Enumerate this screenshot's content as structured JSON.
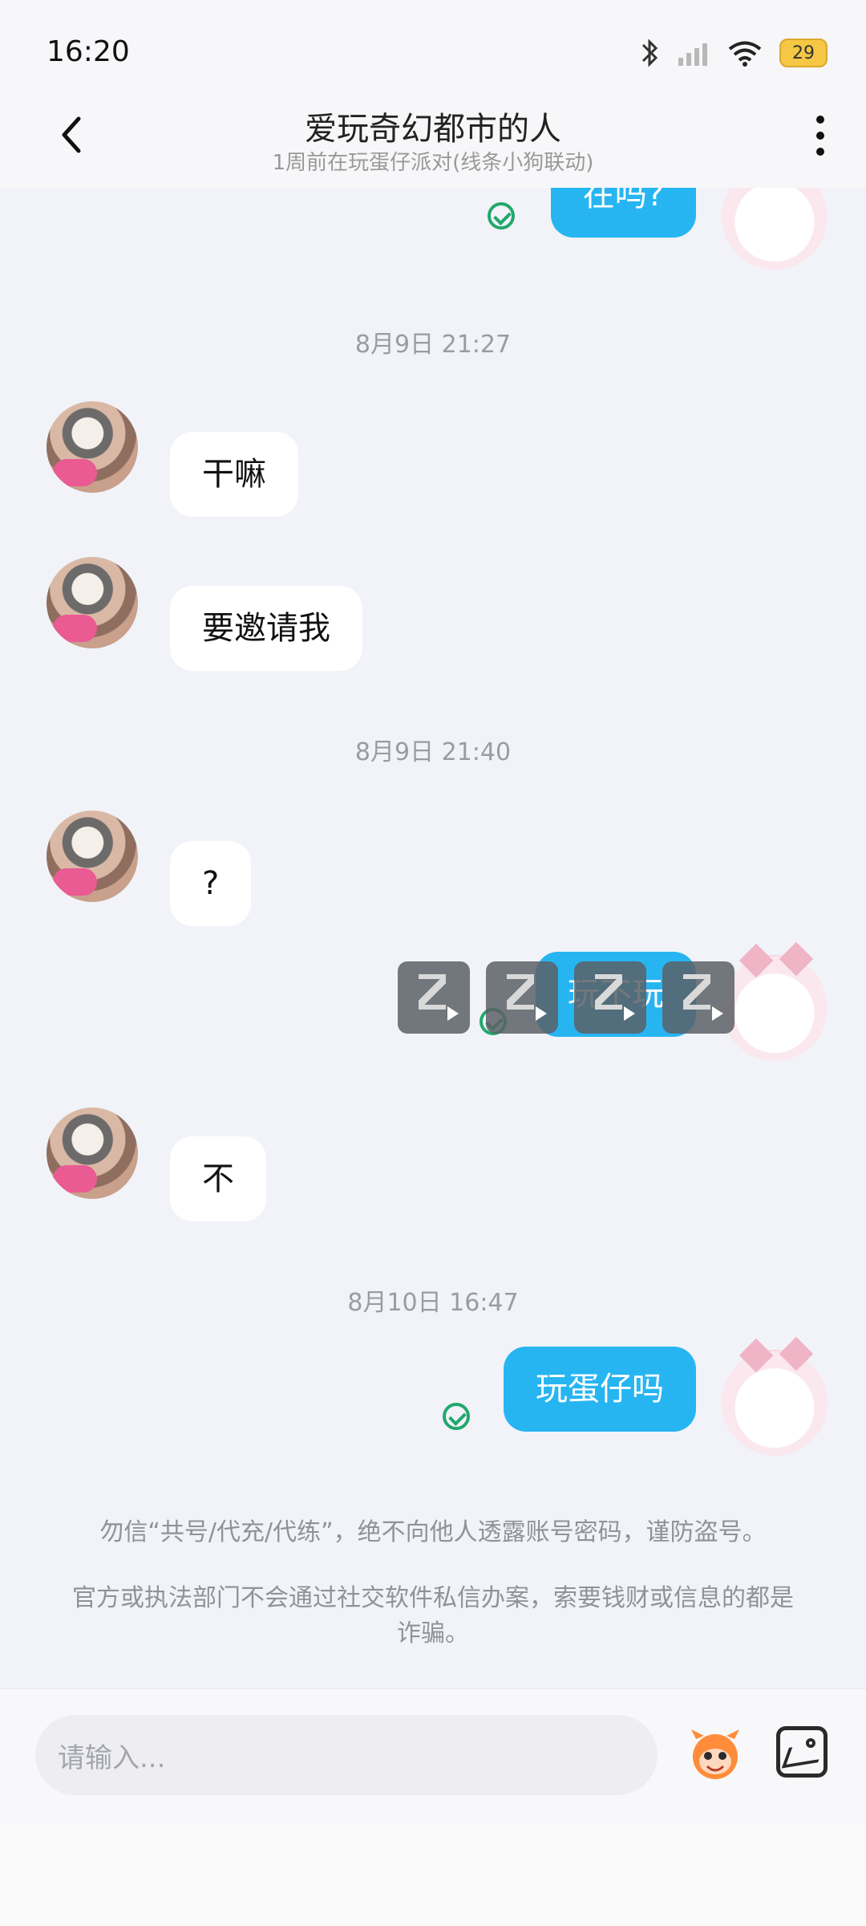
{
  "status_bar": {
    "time": "16:20",
    "battery": "29",
    "icons": [
      "bluetooth-icon",
      "signal-icon",
      "wifi-icon",
      "battery-icon"
    ]
  },
  "header": {
    "title": "爱玩奇幻都市的人",
    "subtitle": "1周前在玩蛋仔派对(线条小狗联动)"
  },
  "messages": [
    {
      "type": "outgoing",
      "text": "在吗?"
    },
    {
      "type": "timestamp",
      "text": "8月9日 21:27"
    },
    {
      "type": "incoming",
      "text": "干嘛"
    },
    {
      "type": "incoming",
      "text": "要邀请我"
    },
    {
      "type": "timestamp",
      "text": "8月9日 21:40"
    },
    {
      "type": "incoming",
      "text": "?"
    },
    {
      "type": "outgoing",
      "text": "玩不玩"
    },
    {
      "type": "incoming",
      "text": "不"
    },
    {
      "type": "timestamp",
      "text": "8月10日 16:47"
    },
    {
      "type": "outgoing",
      "text": "玩蛋仔吗"
    }
  ],
  "notices": [
    "勿信“共号/代充/代练”，绝不向他人透露账号密码，谨防盗号。",
    "官方或执法部门不会通过社交软件私信办案，索要钱财或信息的都是诈骗。"
  ],
  "input": {
    "placeholder": "请输入..."
  },
  "colors": {
    "outgoing_bubble": "#27b5f2",
    "incoming_bubble": "#ffffff",
    "background": "#f1f3f9",
    "check": "#22a86d"
  }
}
